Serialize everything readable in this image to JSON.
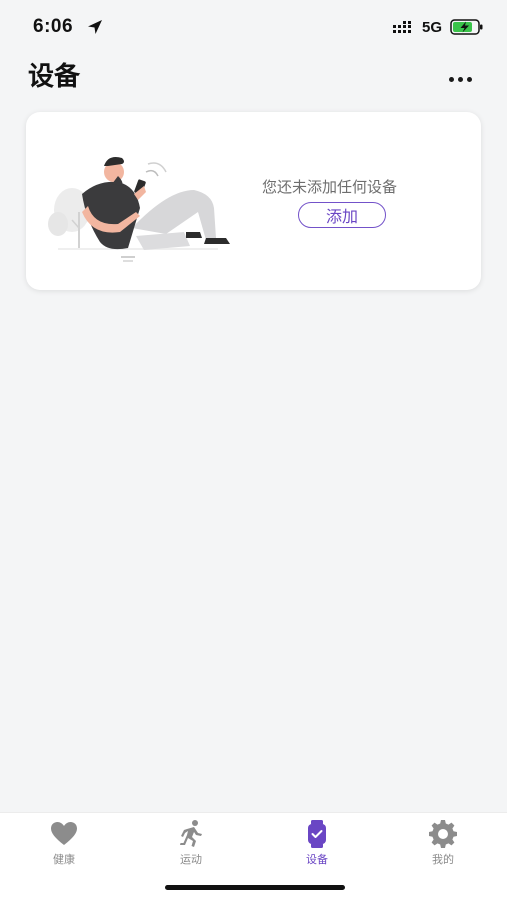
{
  "status_bar": {
    "time": "6:06",
    "network": "5G",
    "icons": [
      "location-arrow-icon",
      "cellular-signal-icon",
      "battery-charging-icon"
    ]
  },
  "header": {
    "title": "设备",
    "more_icon": "more-horizontal-icon"
  },
  "device_card": {
    "empty_message": "您还未添加任何设备",
    "add_button_label": "添加",
    "illustration": "person-using-phone-illustration"
  },
  "tab_bar": {
    "tabs": [
      {
        "label": "健康",
        "icon": "heart-icon",
        "active": false
      },
      {
        "label": "运动",
        "icon": "running-icon",
        "active": false
      },
      {
        "label": "设备",
        "icon": "watch-icon",
        "active": true
      },
      {
        "label": "我的",
        "icon": "gear-icon",
        "active": false
      }
    ]
  },
  "colors": {
    "accent": "#6a46c4",
    "background": "#f4f5f6",
    "card": "#ffffff",
    "inactive_tab": "#8a8a8a",
    "battery_green": "#3ac34a"
  }
}
